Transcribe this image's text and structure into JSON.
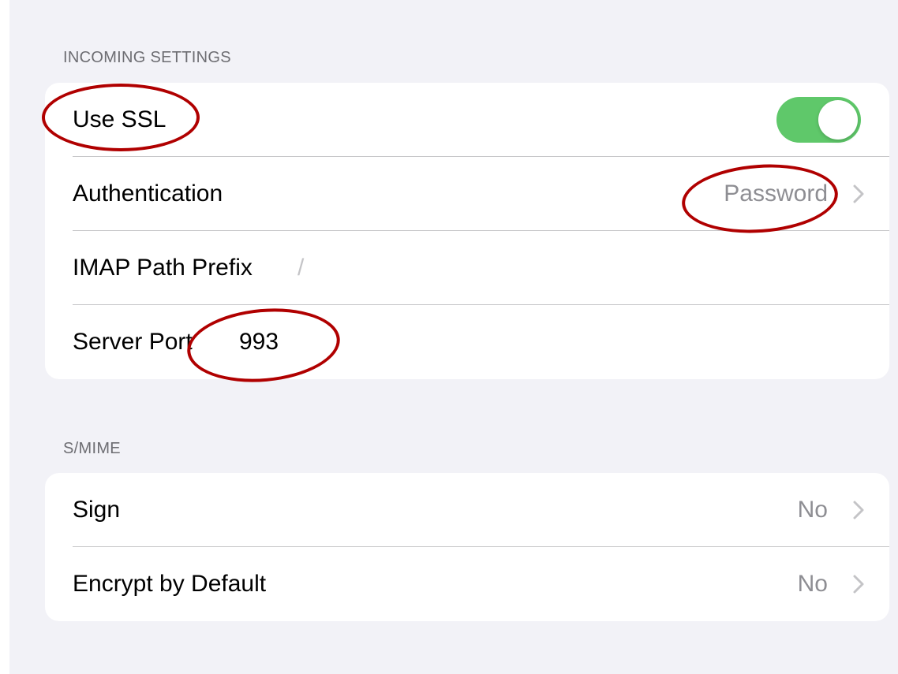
{
  "incoming_settings": {
    "header": "INCOMING SETTINGS",
    "use_ssl": {
      "label": "Use SSL",
      "enabled": true
    },
    "authentication": {
      "label": "Authentication",
      "value": "Password"
    },
    "imap_path_prefix": {
      "label": "IMAP Path Prefix",
      "value": "/"
    },
    "server_port": {
      "label": "Server Port",
      "value": "993"
    }
  },
  "smime": {
    "header": "S/MIME",
    "sign": {
      "label": "Sign",
      "value": "No"
    },
    "encrypt_by_default": {
      "label": "Encrypt by Default",
      "value": "No"
    }
  },
  "colors": {
    "toggle_on": "#5fc86a",
    "annotation": "#b00000",
    "secondary_text": "#8e8e93"
  }
}
